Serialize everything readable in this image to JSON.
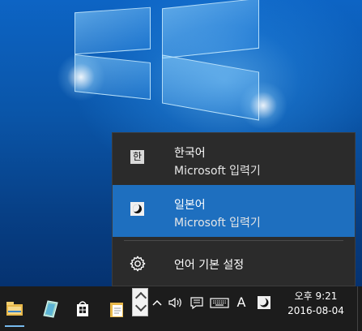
{
  "language_menu": {
    "items": [
      {
        "badge": "한",
        "name": "한국어",
        "ime": "Microsoft 입력기",
        "selected": false
      },
      {
        "badge": "",
        "name": "일본어",
        "ime": "Microsoft 입력기",
        "selected": true
      }
    ],
    "settings_label": "언어 기본 설정"
  },
  "tray": {
    "input_indicator": "A",
    "time": "오후 9:21",
    "date": "2016-08-04"
  },
  "colors": {
    "menu_bg": "#2b2b2b",
    "selected_bg": "#1e6fbf",
    "taskbar_bg": "#1c1c1c",
    "accent_underline": "#76b9ed"
  }
}
